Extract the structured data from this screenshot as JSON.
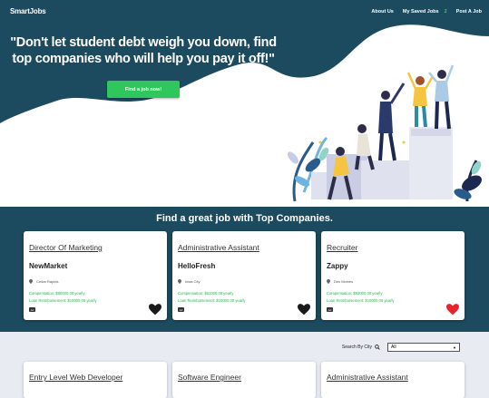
{
  "nav": {
    "brand": "SmartJobs",
    "links": [
      "About Us",
      "My Saved Jobs",
      "Post A Job"
    ],
    "saved_count": "2"
  },
  "hero": {
    "headline": "\"Don't let student debt weigh you down, find top companies who will help you pay it off!\"",
    "cta_label": "Find a job now!"
  },
  "featured": {
    "title": "Find a great job with Top Companies.",
    "jobs": [
      {
        "title": "Director Of Marketing",
        "company": "NewMarket",
        "location": "Cedar Rapids",
        "compensation": "Compensation: $80000.00 yearly",
        "loan": "Loan Reimbursement: $10000.00 yearly",
        "badge": "Ad",
        "saved": false
      },
      {
        "title": "Administrative Assistant",
        "company": "HelloFresh",
        "location": "Iowa City",
        "compensation": "Compensation: $61000.00 yearly",
        "loan": "Loan Reimbursement: $10000.00 yearly",
        "badge": "Ad",
        "saved": false
      },
      {
        "title": "Recruiter",
        "company": "Zappy",
        "location": "Des Moines",
        "compensation": "Compensation: $82000.00 yearly",
        "loan": "Loan Reimbursement: $10000.00 yearly",
        "badge": "Ad",
        "saved": true
      }
    ]
  },
  "search": {
    "label": "Search By City",
    "selected": "All"
  },
  "listing": {
    "jobs": [
      {
        "title": "Entry Level Web Developer"
      },
      {
        "title": "Software Engineer"
      },
      {
        "title": "Administrative Assistant"
      }
    ]
  },
  "colors": {
    "navy": "#1c4a5e",
    "accent_green": "#2fc75d",
    "heart_saved": "#e8232b",
    "heart_default": "#1a1a1a"
  }
}
